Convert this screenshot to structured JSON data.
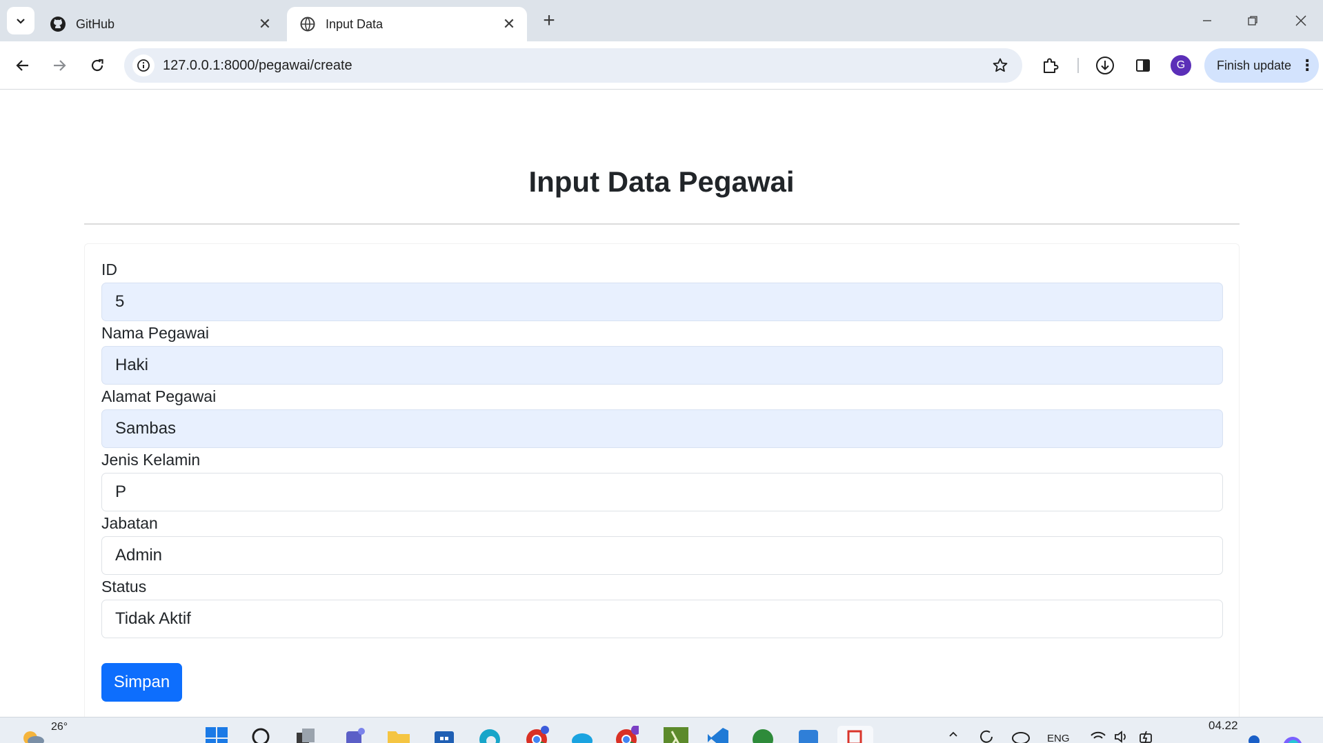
{
  "browser": {
    "tabs": [
      {
        "title": "GitHub",
        "icon": "github-icon"
      },
      {
        "title": "Input Data",
        "icon": "globe-icon",
        "active": true
      }
    ],
    "url": "127.0.0.1:8000/pegawai/create",
    "finish_update_label": "Finish update",
    "profile_initial": "G"
  },
  "page": {
    "title": "Input Data Pegawai",
    "fields": [
      {
        "label": "ID",
        "value": "5",
        "autofilled": true
      },
      {
        "label": "Nama Pegawai",
        "value": "Haki",
        "autofilled": true
      },
      {
        "label": "Alamat Pegawai",
        "value": "Sambas",
        "autofilled": true
      },
      {
        "label": "Jenis Kelamin",
        "value": "P",
        "autofilled": false
      },
      {
        "label": "Jabatan",
        "value": "Admin",
        "autofilled": false
      },
      {
        "label": "Status",
        "value": "Tidak Aktif",
        "autofilled": false
      }
    ],
    "submit_label": "Simpan"
  },
  "taskbar": {
    "temperature": "26°",
    "language": "ENG",
    "time": "04.22"
  },
  "colors": {
    "primary": "#0d6efd",
    "autofill_bg": "#e8f0fe",
    "tabbar_bg": "#dde3ea",
    "omnibox_bg": "#e9eef6",
    "finish_update_bg": "#d3e3fd"
  }
}
